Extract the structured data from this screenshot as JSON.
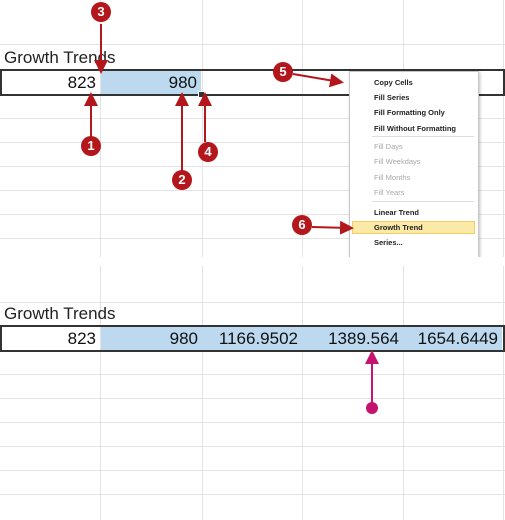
{
  "top": {
    "title": "Growth Trends",
    "cells": [
      "823",
      "980"
    ],
    "callouts": [
      "1",
      "2",
      "3",
      "4",
      "5",
      "6"
    ],
    "menu": {
      "items": [
        {
          "label": "Copy Cells",
          "enabled": true
        },
        {
          "label": "Fill Series",
          "enabled": true
        },
        {
          "label": "Fill Formatting Only",
          "enabled": true
        },
        {
          "label": "Fill Without Formatting",
          "enabled": true
        },
        {
          "label": "Fill Days",
          "enabled": false
        },
        {
          "label": "Fill Weekdays",
          "enabled": false
        },
        {
          "label": "Fill Months",
          "enabled": false
        },
        {
          "label": "Fill Years",
          "enabled": false
        },
        {
          "label": "Linear Trend",
          "enabled": true
        },
        {
          "label": "Growth Trend",
          "enabled": true,
          "highlighted": true
        },
        {
          "label": "Series...",
          "enabled": true
        }
      ]
    }
  },
  "bottom": {
    "title": "Growth Trends",
    "cells": [
      "823",
      "980",
      "1166.9502",
      "1389.564",
      "1654.6449"
    ]
  },
  "colors": {
    "callout": "#b3161b",
    "arrow": "#b3161b",
    "result_arrow": "#c4146f",
    "selection": "#bcd9f0",
    "menu_highlight": "#fbe9a8"
  }
}
